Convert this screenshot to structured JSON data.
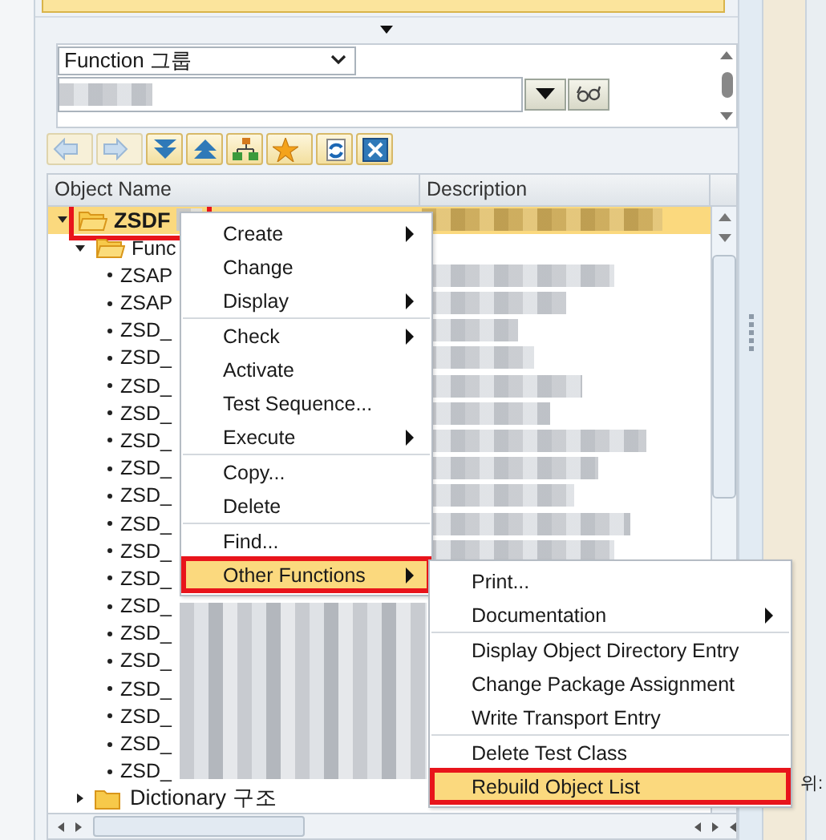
{
  "selection": {
    "dropdown": "Function 그룹"
  },
  "toolbar": [
    {
      "kind": "back",
      "disabled": true
    },
    {
      "kind": "forward",
      "disabled": true
    },
    {
      "kind": "expand",
      "disabled": false
    },
    {
      "kind": "collapse",
      "disabled": false
    },
    {
      "kind": "hierarchy",
      "disabled": false
    },
    {
      "kind": "favorite",
      "disabled": false
    },
    {
      "kind": "refresh",
      "disabled": false
    },
    {
      "kind": "close",
      "disabled": false
    }
  ],
  "tree": {
    "columns": [
      "Object Name",
      "Description"
    ],
    "items": [
      {
        "label": "ZSDF",
        "expanded": true,
        "selected": true,
        "marked": true,
        "children": [
          {
            "label": "Func",
            "expanded": true,
            "selected": false,
            "marked": false,
            "children": [
              {
                "label": "ZSAP"
              },
              {
                "label": "ZSAP"
              },
              {
                "label": "ZSD_"
              },
              {
                "label": "ZSD_"
              },
              {
                "label": "ZSD_"
              },
              {
                "label": "ZSD_"
              },
              {
                "label": "ZSD_"
              },
              {
                "label": "ZSD_"
              },
              {
                "label": "ZSD_"
              },
              {
                "label": "ZSD_"
              },
              {
                "label": "ZSD_"
              },
              {
                "label": "ZSD_"
              },
              {
                "label": "ZSD_"
              },
              {
                "label": "ZSD_"
              },
              {
                "label": "ZSD_"
              },
              {
                "label": "ZSD_"
              },
              {
                "label": "ZSD_"
              },
              {
                "label": "ZSD_"
              },
              {
                "label": "ZSD_"
              }
            ]
          }
        ]
      },
      {
        "label": "Dictionary 구조",
        "expanded": false,
        "selected": false,
        "marked": false
      }
    ]
  },
  "context_menu": [
    {
      "label": "Create",
      "submenu": true,
      "selected": false,
      "marked": false,
      "group_end": false
    },
    {
      "label": "Change",
      "submenu": false,
      "selected": false,
      "marked": false,
      "group_end": false
    },
    {
      "label": "Display",
      "submenu": true,
      "selected": false,
      "marked": false,
      "group_end": true
    },
    {
      "label": "Check",
      "submenu": true,
      "selected": false,
      "marked": false,
      "group_end": false
    },
    {
      "label": "Activate",
      "submenu": false,
      "selected": false,
      "marked": false,
      "group_end": false
    },
    {
      "label": "Test Sequence...",
      "submenu": false,
      "selected": false,
      "marked": false,
      "group_end": false
    },
    {
      "label": "Execute",
      "submenu": true,
      "selected": false,
      "marked": false,
      "group_end": true
    },
    {
      "label": "Copy...",
      "submenu": false,
      "selected": false,
      "marked": false,
      "group_end": false
    },
    {
      "label": "Delete",
      "submenu": false,
      "selected": false,
      "marked": false,
      "group_end": true
    },
    {
      "label": "Find...",
      "submenu": false,
      "selected": false,
      "marked": false,
      "group_end": false
    },
    {
      "label": "Other Functions",
      "submenu": true,
      "selected": true,
      "marked": true,
      "group_end": false
    }
  ],
  "submenu": [
    {
      "label": "Print...",
      "submenu": false,
      "selected": false,
      "marked": false,
      "group_end": false
    },
    {
      "label": "Documentation",
      "submenu": true,
      "selected": false,
      "marked": false,
      "group_end": true
    },
    {
      "label": "Display Object Directory Entry",
      "submenu": false,
      "selected": false,
      "marked": false,
      "group_end": false
    },
    {
      "label": "Change Package Assignment",
      "submenu": false,
      "selected": false,
      "marked": false,
      "group_end": false
    },
    {
      "label": "Write Transport Entry",
      "submenu": false,
      "selected": false,
      "marked": false,
      "group_end": true
    },
    {
      "label": "Delete Test Class",
      "submenu": false,
      "selected": false,
      "marked": false,
      "group_end": false
    },
    {
      "label": "Rebuild Object List",
      "submenu": false,
      "selected": true,
      "marked": true,
      "group_end": false
    }
  ],
  "side_label": "위:"
}
